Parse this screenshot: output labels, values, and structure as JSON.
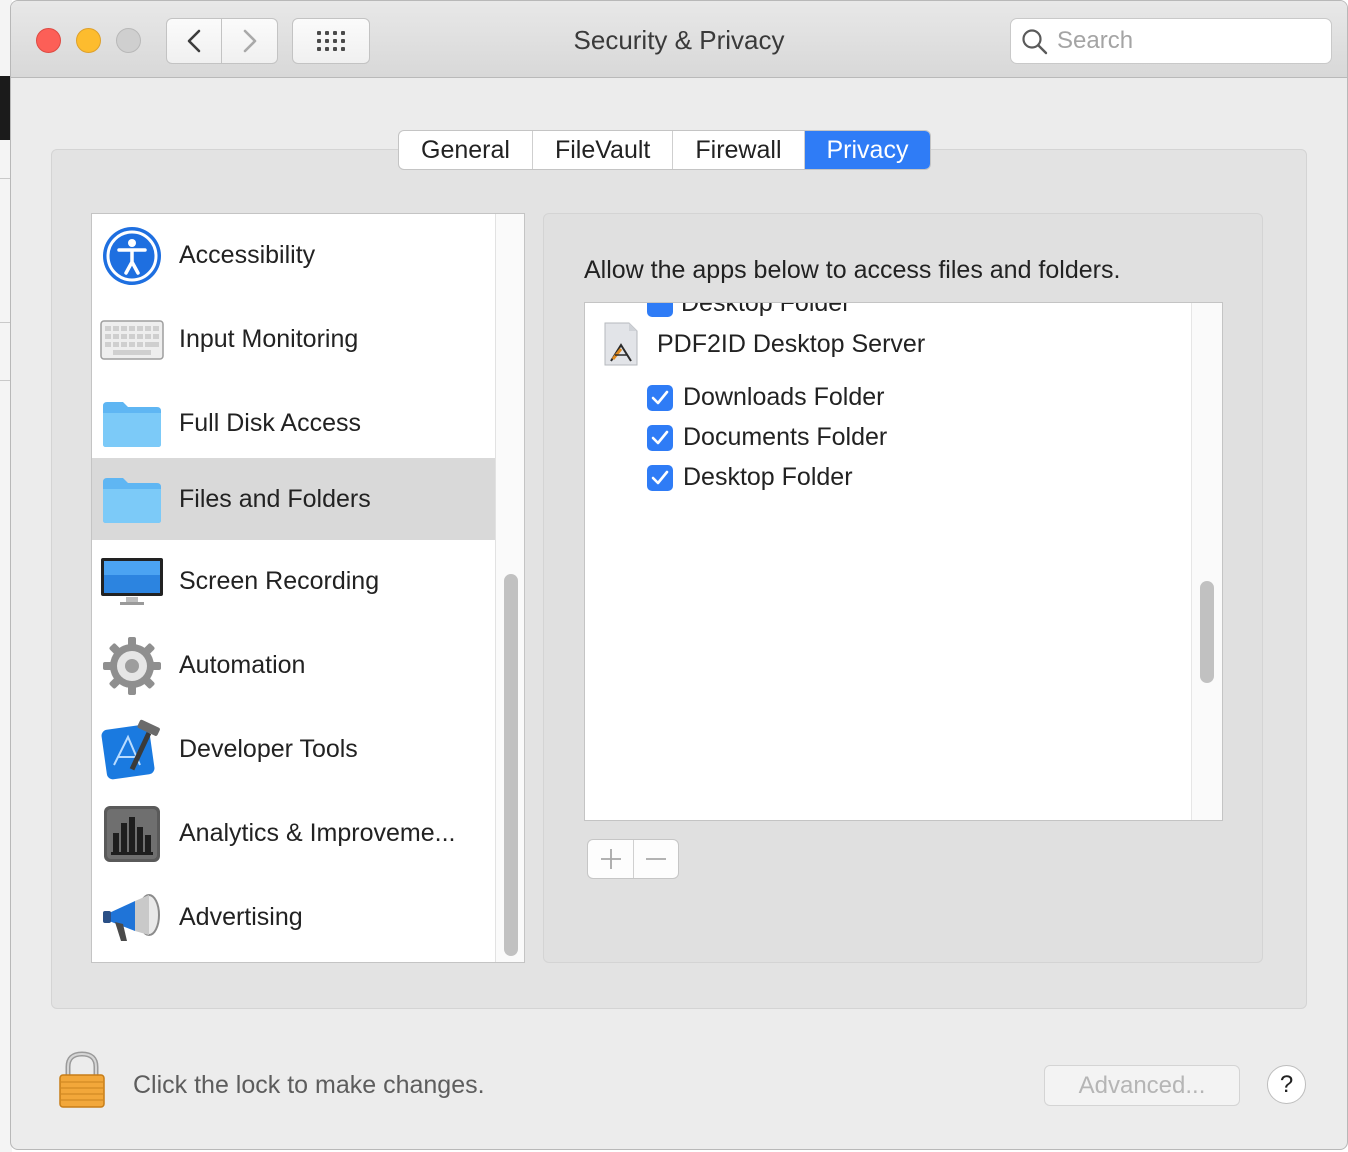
{
  "window": {
    "title": "Security & Privacy"
  },
  "search": {
    "placeholder": "Search"
  },
  "tabs": [
    {
      "label": "General"
    },
    {
      "label": "FileVault"
    },
    {
      "label": "Firewall"
    },
    {
      "label": "Privacy",
      "active": true
    }
  ],
  "categories": [
    {
      "label": "Accessibility",
      "icon": "accessibility-icon"
    },
    {
      "label": "Input Monitoring",
      "icon": "keyboard-icon"
    },
    {
      "label": "Full Disk Access",
      "icon": "folder-icon"
    },
    {
      "label": "Files and Folders",
      "icon": "folder-icon",
      "selected": true
    },
    {
      "label": "Screen Recording",
      "icon": "display-icon"
    },
    {
      "label": "Automation",
      "icon": "gear-icon"
    },
    {
      "label": "Developer Tools",
      "icon": "xcode-hammer-icon"
    },
    {
      "label": "Analytics & Improveme...",
      "icon": "bar-chart-icon"
    },
    {
      "label": "Advertising",
      "icon": "megaphone-icon"
    }
  ],
  "panel": {
    "heading": "Allow the apps below to access files and folders.",
    "clipped_item": "Desktop Folder",
    "app": {
      "name": "PDF2ID Desktop Server",
      "icon": "app-installer-icon",
      "permissions": [
        {
          "label": "Downloads Folder",
          "checked": true
        },
        {
          "label": "Documents Folder",
          "checked": true
        },
        {
          "label": "Desktop Folder",
          "checked": true
        }
      ]
    },
    "add_label": "+",
    "remove_label": "−"
  },
  "footer": {
    "lock_text": "Click the lock to make changes.",
    "advanced_label": "Advanced...",
    "help_label": "?"
  },
  "colors": {
    "accent": "#2f7cf6",
    "close": "#fc5f57",
    "minimize": "#fdbc2e"
  }
}
